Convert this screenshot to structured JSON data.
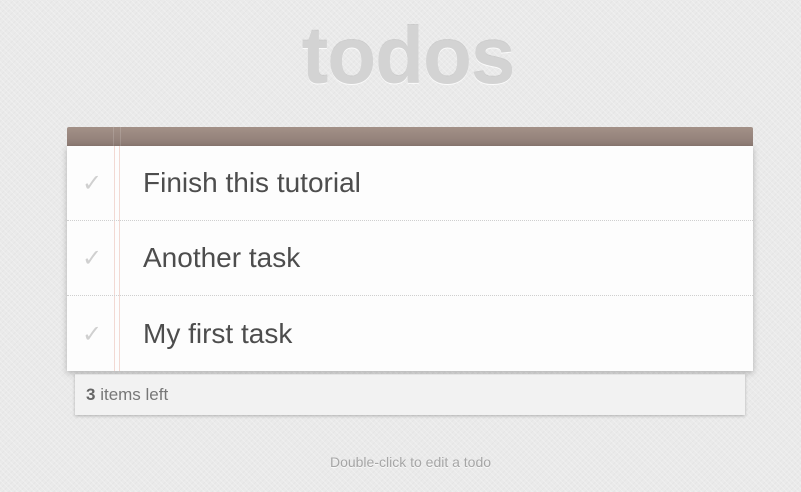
{
  "app": {
    "title": "todos"
  },
  "todos": [
    {
      "label": "Finish this tutorial",
      "completed": false,
      "check_icon": "checkmark-icon"
    },
    {
      "label": "Another task",
      "completed": false,
      "check_icon": "checkmark-icon"
    },
    {
      "label": "My first task",
      "completed": false,
      "check_icon": "checkmark-icon"
    }
  ],
  "footer": {
    "count": "3",
    "count_suffix": " items left"
  },
  "info": {
    "hint": "Double-click to edit a todo"
  },
  "colors": {
    "header_bar": "#8d7b74",
    "title_text": "#d3d3d3",
    "item_text": "#4d4d4d",
    "check_mark": "#d0d0d0",
    "background": "#eaeaea"
  }
}
